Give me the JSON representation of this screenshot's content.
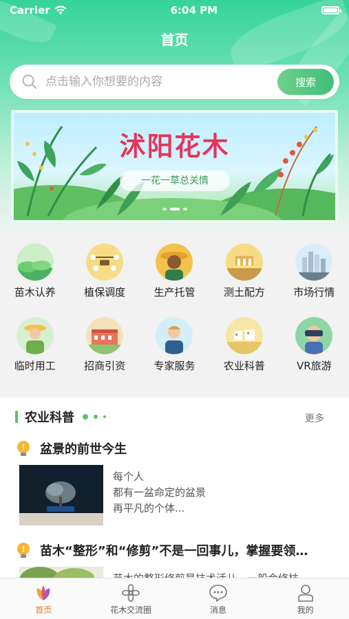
{
  "status_bar": {
    "carrier": "Carrier",
    "time": "6:04 PM"
  },
  "header": {
    "title": "首页"
  },
  "search": {
    "placeholder": "点击输入你想要的内容",
    "button_label": "搜索"
  },
  "banner": {
    "title": "沭阳花木",
    "subtitle": "一花一草总关情",
    "slide_count": 3,
    "active_slide": 1
  },
  "grid": {
    "items": [
      {
        "label": "苗木认养",
        "icon": "field-icon"
      },
      {
        "label": "植保调度",
        "icon": "drone-icon"
      },
      {
        "label": "生产托管",
        "icon": "farmer-icon"
      },
      {
        "label": "测土配方",
        "icon": "soil-test-icon"
      },
      {
        "label": "市场行情",
        "icon": "city-icon"
      },
      {
        "label": "临时用工",
        "icon": "worker-icon"
      },
      {
        "label": "招商引资",
        "icon": "building-icon"
      },
      {
        "label": "专家服务",
        "icon": "expert-icon"
      },
      {
        "label": "农业科普",
        "icon": "farm-icon"
      },
      {
        "label": "VR旅游",
        "icon": "vr-icon"
      }
    ]
  },
  "section": {
    "title": "农业科普",
    "more_label": "更多",
    "articles": [
      {
        "title": "盆景的前世今生",
        "excerpt": [
          "每个人",
          "都有一盆命定的盆景",
          "再平凡的个体..."
        ]
      },
      {
        "title": "苗木“整形”和“修剪”不是一回事儿，掌握要领…",
        "excerpt": [
          "苗木的整形修剪是技术活儿，一般会修枝"
        ]
      }
    ]
  },
  "tabbar": {
    "tabs": [
      {
        "label": "首页",
        "active": true
      },
      {
        "label": "花木交流圈",
        "active": false
      },
      {
        "label": "消息",
        "active": false
      },
      {
        "label": "我的",
        "active": false
      }
    ]
  },
  "colors": {
    "brand_green": "#3fbf7a",
    "accent_orange": "#e07a2d",
    "banner_title": "#e8335b"
  }
}
